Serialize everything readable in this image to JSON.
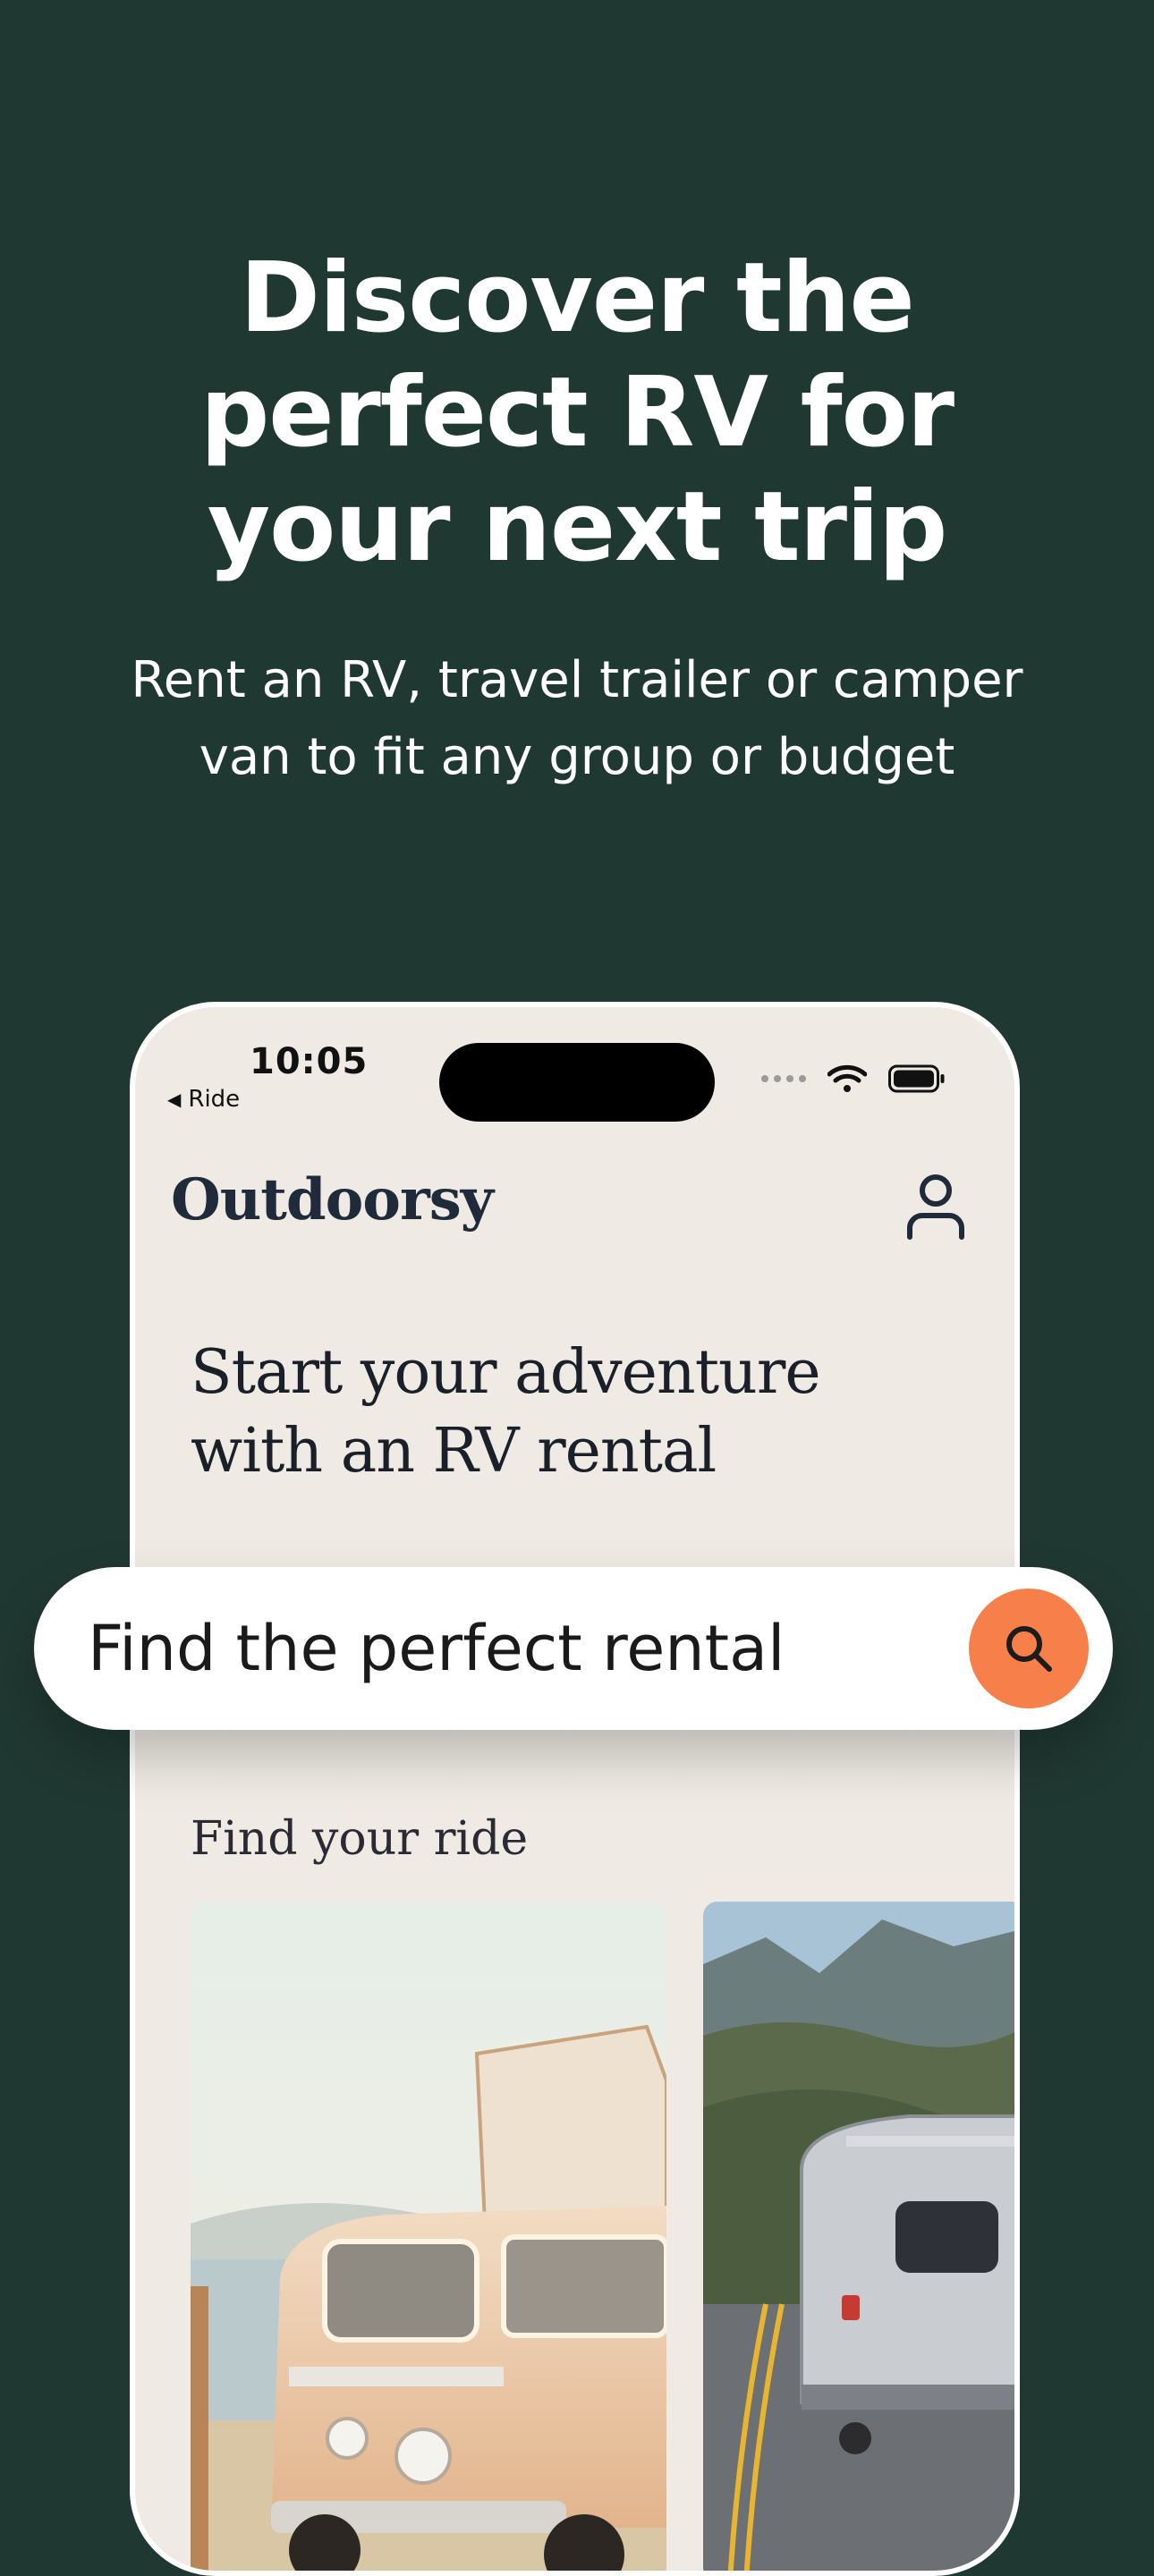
{
  "hero": {
    "title_line1": "Discover the",
    "title_line2": "perfect RV for",
    "title_line3": "your next trip",
    "subtitle_line1": "Rent an RV, travel trailer or camper",
    "subtitle_line2": "van to fit any group or budget"
  },
  "status_bar": {
    "time": "10:05",
    "back_label": "Ride"
  },
  "app": {
    "brand": "Outdoorsy",
    "headline_line1": "Start your adventure",
    "headline_line2": "with an RV rental",
    "section_title": "Find your ride"
  },
  "search": {
    "placeholder": "Find the perfect rental"
  },
  "icons": {
    "account": "person-icon",
    "search": "search-icon",
    "wifi": "wifi-icon",
    "battery": "battery-icon",
    "signal": "signal-dots-icon"
  },
  "colors": {
    "background": "#203832",
    "phone_background": "#efebe4",
    "accent": "#f7804a"
  }
}
